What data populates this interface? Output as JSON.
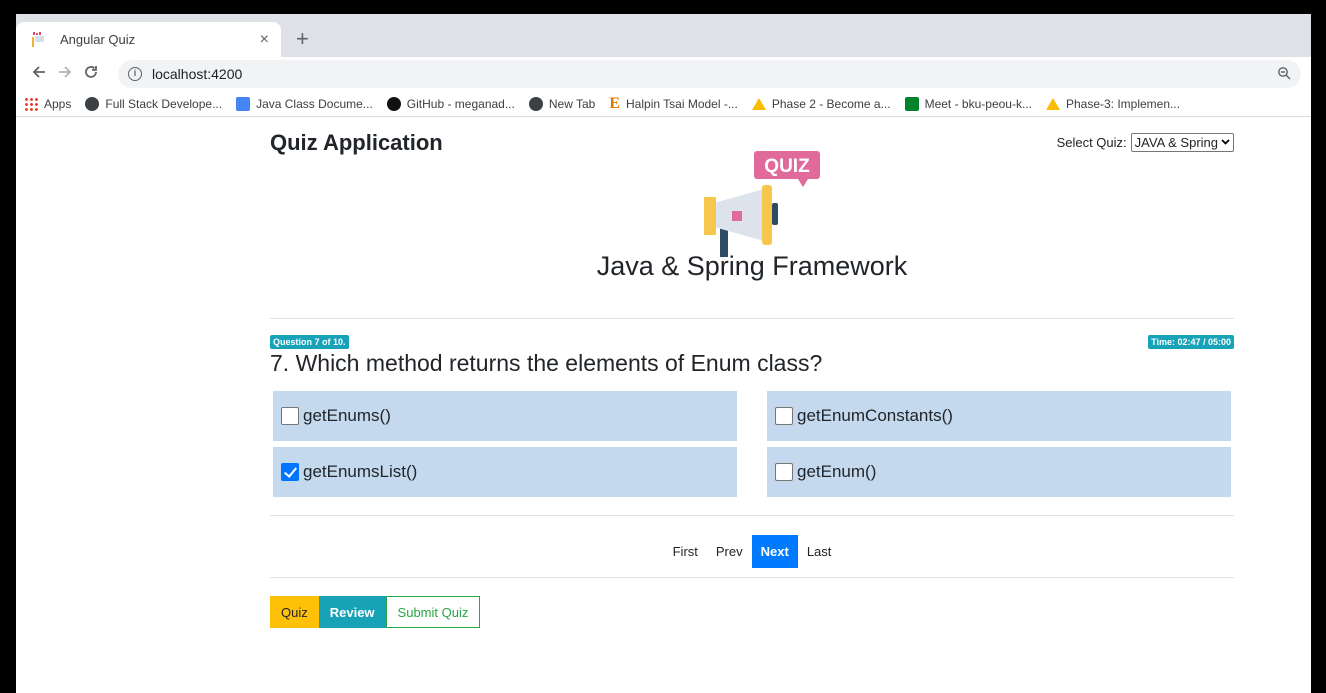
{
  "browser": {
    "tab_title": "Angular Quiz",
    "close_glyph": "×",
    "new_tab_glyph": "+",
    "url": "localhost:4200",
    "icons": [
      "back-icon",
      "forward-icon",
      "reload-icon",
      "info-icon",
      "zoom-icon"
    ],
    "bookmarks": [
      {
        "label": "Apps",
        "icon": "apps-grid-icon"
      },
      {
        "label": "Full Stack Develope...",
        "icon": "globe-icon"
      },
      {
        "label": "Java Class Docume...",
        "icon": "docs-icon"
      },
      {
        "label": "GitHub - meganad...",
        "icon": "github-icon"
      },
      {
        "label": "New Tab",
        "icon": "globe-icon"
      },
      {
        "label": "Halpin Tsai Model -...",
        "icon": "e-icon"
      },
      {
        "label": "Phase 2 - Become a...",
        "icon": "drive-icon"
      },
      {
        "label": "Meet - bku-peou-k...",
        "icon": "meet-icon"
      },
      {
        "label": "Phase-3: Implemen...",
        "icon": "drive-icon"
      }
    ]
  },
  "app": {
    "brand": "Quiz Application",
    "select_label": "Select Quiz:",
    "selected_quiz": "JAVA & Spring",
    "logo_text": "QUIZ",
    "quiz_name": "Java & Spring Framework",
    "question_badge": "Question 7 of 10.",
    "timer_badge": "Time: 02:47 / 05:00",
    "question": "7. Which method returns the elements of Enum class?",
    "options": [
      {
        "label": "getEnums()",
        "checked": false
      },
      {
        "label": "getEnumConstants()",
        "checked": false
      },
      {
        "label": "getEnumsList()",
        "checked": true
      },
      {
        "label": "getEnum()",
        "checked": false
      }
    ],
    "pager": {
      "first": "First",
      "prev": "Prev",
      "next": "Next",
      "last": "Last"
    },
    "actions": {
      "quiz": "Quiz",
      "review": "Review",
      "submit": "Submit Quiz"
    },
    "colors": {
      "primary": "#007bff",
      "info": "#17a2b8",
      "warning": "#ffc107",
      "success": "#28a745",
      "option_bg": "#c5d9ee"
    }
  }
}
